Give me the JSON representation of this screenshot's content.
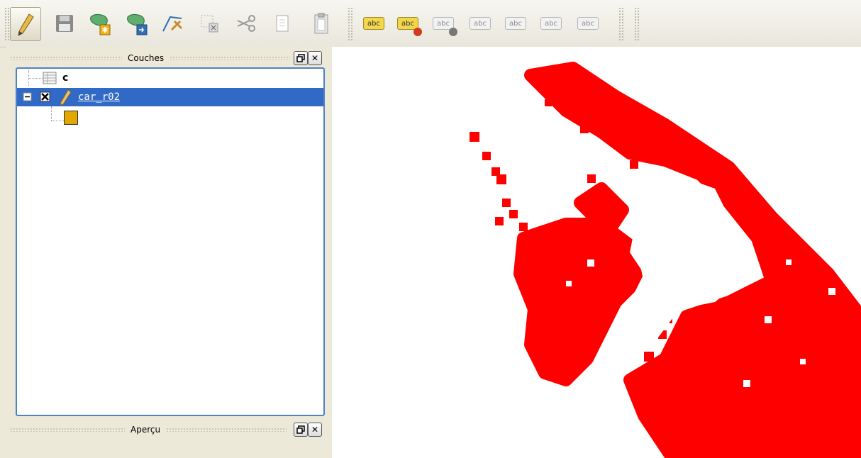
{
  "toolbar": {
    "buttons": [
      {
        "name": "toggle-editing-button",
        "icon": "pencil-icon",
        "active": true
      },
      {
        "name": "save-edits-button",
        "icon": "floppy-disk-icon"
      },
      {
        "name": "add-feature-button",
        "icon": "polygon-add-icon"
      },
      {
        "name": "move-feature-button",
        "icon": "polygon-move-icon"
      },
      {
        "name": "node-tool-button",
        "icon": "node-edit-icon"
      },
      {
        "name": "delete-selected-button",
        "icon": "delete-selection-icon"
      },
      {
        "name": "cut-features-button",
        "icon": "scissors-icon"
      },
      {
        "name": "copy-features-button",
        "icon": "copy-icon"
      },
      {
        "name": "paste-features-button",
        "icon": "paste-icon"
      }
    ],
    "label_tools": [
      {
        "name": "label-layer-button",
        "text": "abc",
        "style": "yellow"
      },
      {
        "name": "label-pin-button",
        "text": "abc",
        "style": "pin"
      },
      {
        "name": "label-move-button",
        "text": "abc",
        "style": "dim"
      },
      {
        "name": "label-show-hide-button",
        "text": "abc",
        "style": "dim"
      },
      {
        "name": "label-move-label-button",
        "text": "abc",
        "style": "dim"
      },
      {
        "name": "label-rotate-button",
        "text": "abc",
        "style": "dim"
      },
      {
        "name": "label-change-button",
        "text": "abc",
        "style": "dim"
      }
    ]
  },
  "layers_panel": {
    "title": "Couches",
    "layers": [
      {
        "name": "c",
        "type": "table"
      },
      {
        "name": "car_r02",
        "type": "editable",
        "selected": true,
        "symbol_color": "#e0a800"
      }
    ]
  },
  "overview_panel": {
    "title": "Aperçu"
  },
  "map": {
    "point_color": "#ff0000",
    "background": "#ffffff"
  }
}
